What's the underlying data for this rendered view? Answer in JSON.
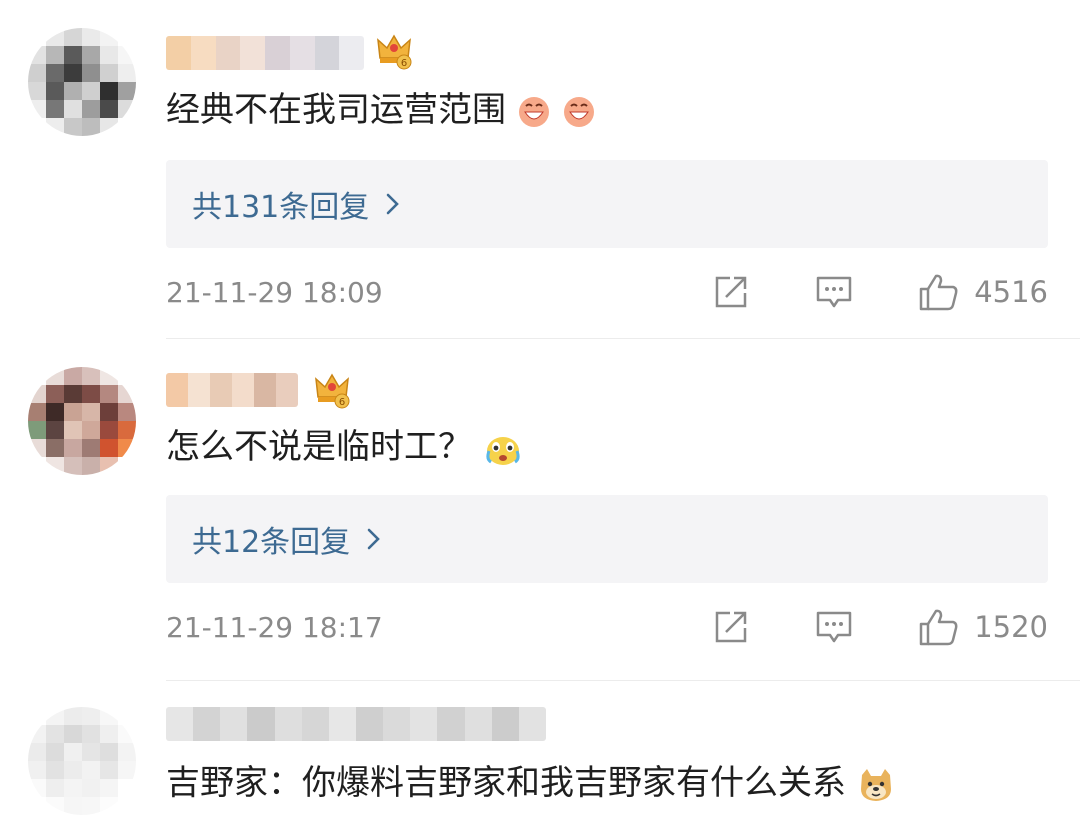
{
  "comments": [
    {
      "text": "经典不在我司运营范围",
      "reply_label": "共131条回复",
      "timestamp": "21-11-29 18:09",
      "like_count": "4516",
      "emoji": [
        "grinning-face-emoji",
        "grinning-face-emoji"
      ],
      "badge": "crown-level-6"
    },
    {
      "text": "怎么不说是临时工？",
      "reply_label": "共12条回复",
      "timestamp": "21-11-29 18:17",
      "like_count": "1520",
      "emoji": [
        "crying-face-emoji"
      ],
      "badge": "crown-level-6"
    },
    {
      "text": "吉野家：你爆料吉野家和我吉野家有什么关系",
      "emoji": [
        "doge-emoji"
      ]
    }
  ],
  "icons": {
    "share": "share-icon",
    "reply": "comment-icon",
    "like": "thumbs-up-icon",
    "chevron": "chevron-right-icon"
  },
  "colors": {
    "reply_link": "#3d6a92",
    "meta_text": "#8a8a8a",
    "reply_bg": "#f4f4f6"
  }
}
